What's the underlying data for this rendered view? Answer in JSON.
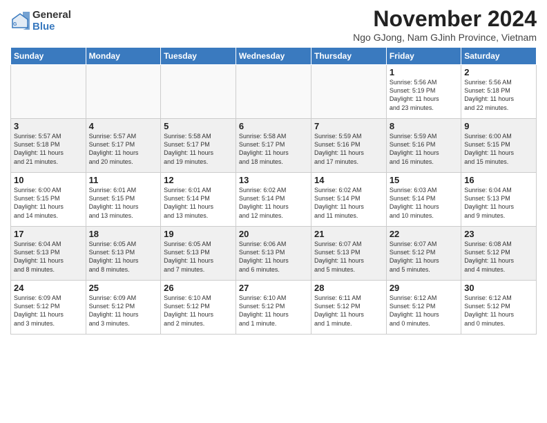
{
  "logo": {
    "general": "General",
    "blue": "Blue"
  },
  "title": "November 2024",
  "location": "Ngo GJong, Nam GJinh Province, Vietnam",
  "days_header": [
    "Sunday",
    "Monday",
    "Tuesday",
    "Wednesday",
    "Thursday",
    "Friday",
    "Saturday"
  ],
  "weeks": [
    [
      {
        "day": "",
        "info": ""
      },
      {
        "day": "",
        "info": ""
      },
      {
        "day": "",
        "info": ""
      },
      {
        "day": "",
        "info": ""
      },
      {
        "day": "",
        "info": ""
      },
      {
        "day": "1",
        "info": "Sunrise: 5:56 AM\nSunset: 5:19 PM\nDaylight: 11 hours\nand 23 minutes."
      },
      {
        "day": "2",
        "info": "Sunrise: 5:56 AM\nSunset: 5:18 PM\nDaylight: 11 hours\nand 22 minutes."
      }
    ],
    [
      {
        "day": "3",
        "info": "Sunrise: 5:57 AM\nSunset: 5:18 PM\nDaylight: 11 hours\nand 21 minutes."
      },
      {
        "day": "4",
        "info": "Sunrise: 5:57 AM\nSunset: 5:17 PM\nDaylight: 11 hours\nand 20 minutes."
      },
      {
        "day": "5",
        "info": "Sunrise: 5:58 AM\nSunset: 5:17 PM\nDaylight: 11 hours\nand 19 minutes."
      },
      {
        "day": "6",
        "info": "Sunrise: 5:58 AM\nSunset: 5:17 PM\nDaylight: 11 hours\nand 18 minutes."
      },
      {
        "day": "7",
        "info": "Sunrise: 5:59 AM\nSunset: 5:16 PM\nDaylight: 11 hours\nand 17 minutes."
      },
      {
        "day": "8",
        "info": "Sunrise: 5:59 AM\nSunset: 5:16 PM\nDaylight: 11 hours\nand 16 minutes."
      },
      {
        "day": "9",
        "info": "Sunrise: 6:00 AM\nSunset: 5:15 PM\nDaylight: 11 hours\nand 15 minutes."
      }
    ],
    [
      {
        "day": "10",
        "info": "Sunrise: 6:00 AM\nSunset: 5:15 PM\nDaylight: 11 hours\nand 14 minutes."
      },
      {
        "day": "11",
        "info": "Sunrise: 6:01 AM\nSunset: 5:15 PM\nDaylight: 11 hours\nand 13 minutes."
      },
      {
        "day": "12",
        "info": "Sunrise: 6:01 AM\nSunset: 5:14 PM\nDaylight: 11 hours\nand 13 minutes."
      },
      {
        "day": "13",
        "info": "Sunrise: 6:02 AM\nSunset: 5:14 PM\nDaylight: 11 hours\nand 12 minutes."
      },
      {
        "day": "14",
        "info": "Sunrise: 6:02 AM\nSunset: 5:14 PM\nDaylight: 11 hours\nand 11 minutes."
      },
      {
        "day": "15",
        "info": "Sunrise: 6:03 AM\nSunset: 5:14 PM\nDaylight: 11 hours\nand 10 minutes."
      },
      {
        "day": "16",
        "info": "Sunrise: 6:04 AM\nSunset: 5:13 PM\nDaylight: 11 hours\nand 9 minutes."
      }
    ],
    [
      {
        "day": "17",
        "info": "Sunrise: 6:04 AM\nSunset: 5:13 PM\nDaylight: 11 hours\nand 8 minutes."
      },
      {
        "day": "18",
        "info": "Sunrise: 6:05 AM\nSunset: 5:13 PM\nDaylight: 11 hours\nand 8 minutes."
      },
      {
        "day": "19",
        "info": "Sunrise: 6:05 AM\nSunset: 5:13 PM\nDaylight: 11 hours\nand 7 minutes."
      },
      {
        "day": "20",
        "info": "Sunrise: 6:06 AM\nSunset: 5:13 PM\nDaylight: 11 hours\nand 6 minutes."
      },
      {
        "day": "21",
        "info": "Sunrise: 6:07 AM\nSunset: 5:13 PM\nDaylight: 11 hours\nand 5 minutes."
      },
      {
        "day": "22",
        "info": "Sunrise: 6:07 AM\nSunset: 5:12 PM\nDaylight: 11 hours\nand 5 minutes."
      },
      {
        "day": "23",
        "info": "Sunrise: 6:08 AM\nSunset: 5:12 PM\nDaylight: 11 hours\nand 4 minutes."
      }
    ],
    [
      {
        "day": "24",
        "info": "Sunrise: 6:09 AM\nSunset: 5:12 PM\nDaylight: 11 hours\nand 3 minutes."
      },
      {
        "day": "25",
        "info": "Sunrise: 6:09 AM\nSunset: 5:12 PM\nDaylight: 11 hours\nand 3 minutes."
      },
      {
        "day": "26",
        "info": "Sunrise: 6:10 AM\nSunset: 5:12 PM\nDaylight: 11 hours\nand 2 minutes."
      },
      {
        "day": "27",
        "info": "Sunrise: 6:10 AM\nSunset: 5:12 PM\nDaylight: 11 hours\nand 1 minute."
      },
      {
        "day": "28",
        "info": "Sunrise: 6:11 AM\nSunset: 5:12 PM\nDaylight: 11 hours\nand 1 minute."
      },
      {
        "day": "29",
        "info": "Sunrise: 6:12 AM\nSunset: 5:12 PM\nDaylight: 11 hours\nand 0 minutes."
      },
      {
        "day": "30",
        "info": "Sunrise: 6:12 AM\nSunset: 5:12 PM\nDaylight: 11 hours\nand 0 minutes."
      }
    ]
  ]
}
